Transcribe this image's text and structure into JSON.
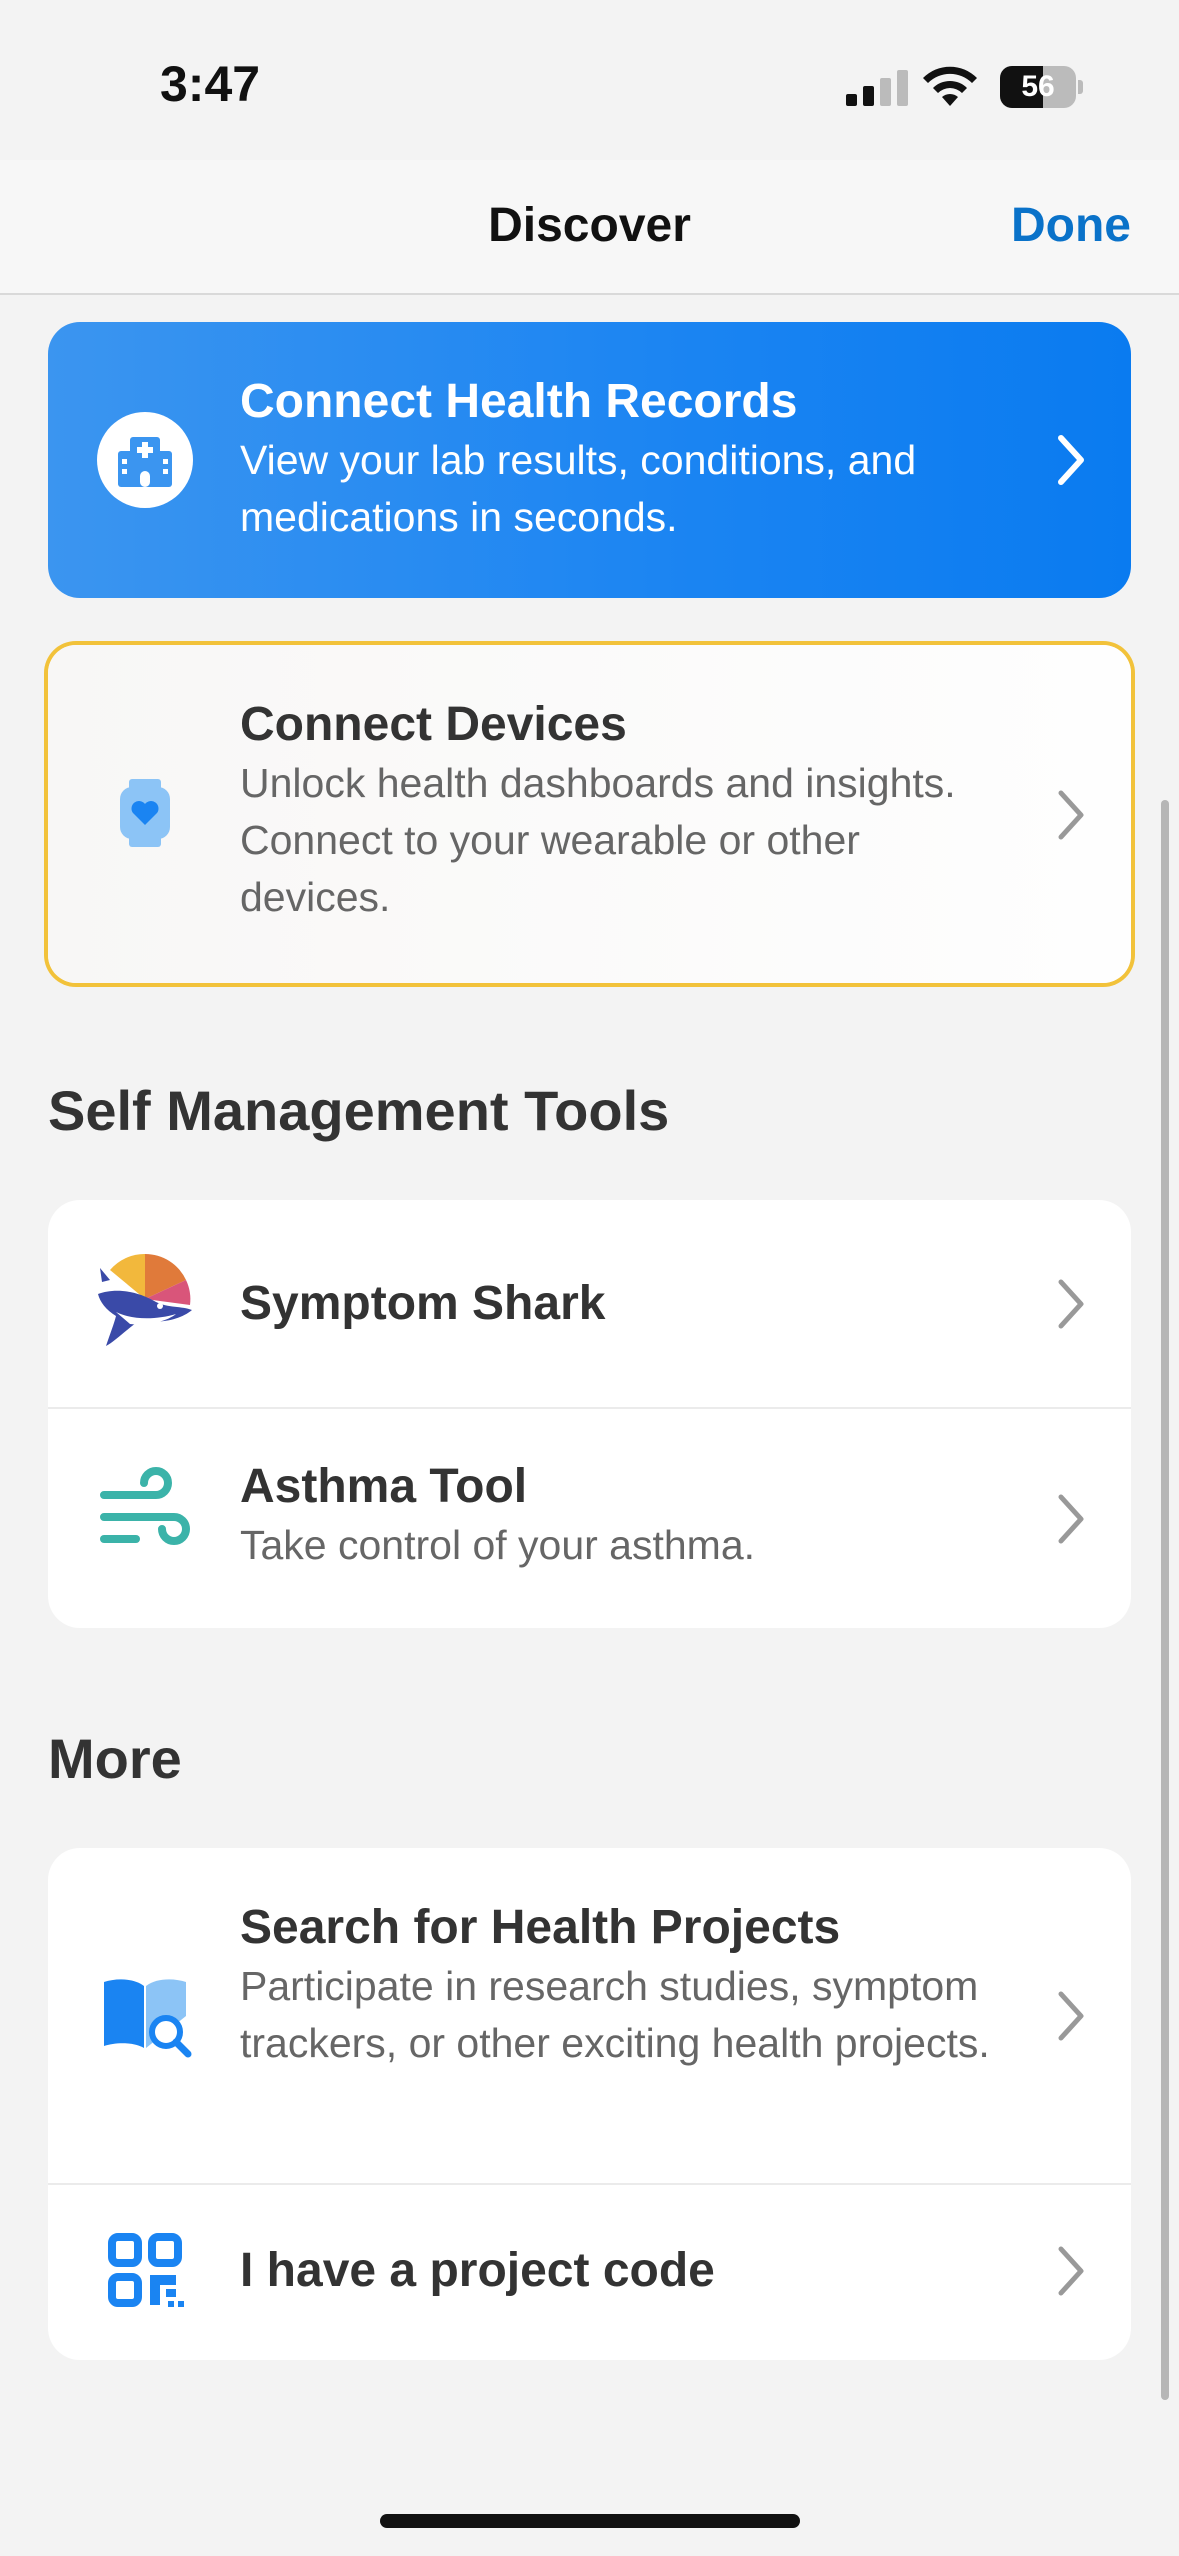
{
  "status_bar": {
    "time": "3:47",
    "battery_level": "56"
  },
  "nav": {
    "title": "Discover",
    "done_label": "Done"
  },
  "health_records": {
    "title": "Connect Health Records",
    "subtitle": "View your lab results, conditions, and medications in seconds."
  },
  "devices": {
    "title": "Connect Devices",
    "subtitle": "Unlock health dashboards and insights. Connect to your wearable or other devices."
  },
  "self_management": {
    "heading": "Self Management Tools",
    "items": [
      {
        "title": "Symptom Shark",
        "subtitle": ""
      },
      {
        "title": "Asthma Tool",
        "subtitle": "Take control of your asthma."
      }
    ]
  },
  "more": {
    "heading": "More",
    "items": [
      {
        "title": "Search for Health Projects",
        "subtitle": "Participate in research studies, symptom trackers, or other exciting health projects."
      },
      {
        "title": "I have a project code",
        "subtitle": ""
      }
    ]
  },
  "colors": {
    "accent": "#0a72c9",
    "hero_start": "#3b95f0",
    "hero_end": "#0a7bf0",
    "highlight": "#f2c23a"
  },
  "icons": {
    "health_records": "hospital-icon",
    "devices": "smartwatch-heart-icon",
    "symptom_shark": "shark-chart-icon",
    "asthma": "wind-icon",
    "search_projects": "book-search-icon",
    "project_code": "qr-code-icon"
  }
}
